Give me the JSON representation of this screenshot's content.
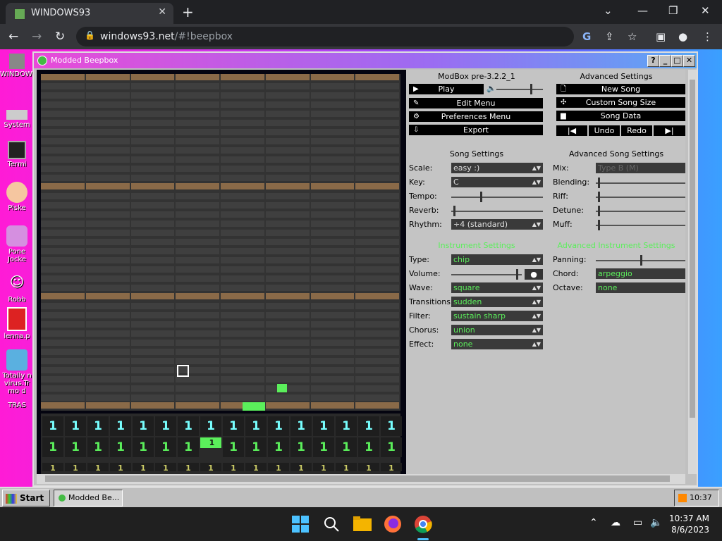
{
  "browser": {
    "tab_title": "WINDOWS93",
    "url_host": "windows93.net",
    "url_path": "/#!beepbox",
    "new_tab": "+",
    "close_tab": "✕"
  },
  "desktop": {
    "icons": [
      {
        "label": "WINDOWS"
      },
      {
        "label": "System"
      },
      {
        "label": "Termi"
      },
      {
        "label": "Piske"
      },
      {
        "label": "Pone Jocke"
      },
      {
        "label": "Robb"
      },
      {
        "label": "lenna.p"
      },
      {
        "label": "Totally n virus.Tr mo d"
      },
      {
        "label": "TRAS"
      }
    ]
  },
  "window": {
    "title": "Modded Beepbox",
    "buttons": {
      "help": "?",
      "min": "_",
      "max": "□",
      "close": "✕"
    }
  },
  "pattern": {
    "row1": [
      "1",
      "1",
      "1",
      "1",
      "1",
      "1",
      "1",
      "1",
      "1",
      "1",
      "1",
      "1",
      "1",
      "1",
      "1",
      "1"
    ],
    "row2": [
      "1",
      "1",
      "1",
      "1",
      "1",
      "1",
      "1",
      "1",
      "1",
      "1",
      "1",
      "1",
      "1",
      "1",
      "1",
      "1"
    ],
    "row3": [
      "1",
      "1",
      "1",
      "1",
      "1",
      "1",
      "1",
      "1",
      "1",
      "1",
      "1",
      "1",
      "1",
      "1",
      "1",
      "1"
    ]
  },
  "left_panel": {
    "version": "ModBox pre-3.2.2_1",
    "play": "Play",
    "edit_menu": "Edit Menu",
    "prefs_menu": "Preferences Menu",
    "export": "Export",
    "song_settings": "Song Settings",
    "labels": {
      "scale": "Scale:",
      "key": "Key:",
      "tempo": "Tempo:",
      "reverb": "Reverb:",
      "rhythm": "Rhythm:",
      "type": "Type:",
      "volume": "Volume:",
      "wave": "Wave:",
      "transitions": "Transitions:",
      "filter": "Filter:",
      "chorus": "Chorus:",
      "effect": "Effect:"
    },
    "values": {
      "scale": "easy :)",
      "key": "C",
      "rhythm": "÷4 (standard)",
      "type": "chip",
      "wave": "square",
      "transitions": "sudden",
      "filter": "sustain sharp",
      "chorus": "union",
      "effect": "none"
    },
    "instrument_settings": "Instrument Settings",
    "volume_btn": "●"
  },
  "right_panel": {
    "advanced_settings": "Advanced Settings",
    "new_song": "New Song",
    "custom_size": "Custom Song Size",
    "song_data": "Song Data",
    "undo": "Undo",
    "redo": "Redo",
    "prev": "|◀",
    "next": "▶|",
    "advanced_song_settings": "Advanced Song Settings",
    "labels": {
      "mix": "Mix:",
      "blending": "Blending:",
      "riff": "Riff:",
      "detune": "Detune:",
      "muff": "Muff:",
      "panning": "Panning:",
      "chord": "Chord:",
      "octave": "Octave:"
    },
    "values": {
      "mix": "Type B (M)",
      "chord": "arpeggio",
      "octave": "none"
    },
    "adv_instrument_settings": "Advanced Instrument Settings"
  },
  "w93_taskbar": {
    "start": "Start",
    "task": "Modded Be...",
    "time": "10:37"
  },
  "win_taskbar": {
    "time": "10:37 AM",
    "date": "8/6/2023"
  },
  "colors": {
    "note_green": "#5bef5b",
    "bar_brown": "#8a6a48",
    "title_gradient_start": "#e84bd8"
  }
}
